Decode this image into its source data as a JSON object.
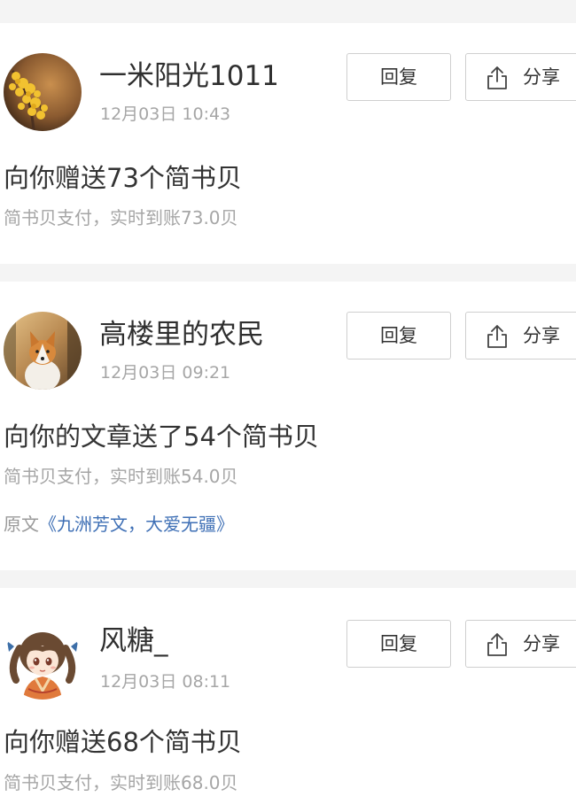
{
  "feed": {
    "items": [
      {
        "username": "一米阳光1011",
        "time": "12月03日 10:43",
        "reply_label": "回复",
        "share_label": "分享",
        "headline": "向你赠送73个简书贝",
        "detail": "简书贝支付，实时到账73.0贝",
        "avatar_icon": "ginkgo-tree-photo"
      },
      {
        "username": "高楼里的农民",
        "time": "12月03日 09:21",
        "reply_label": "回复",
        "share_label": "分享",
        "headline": "向你的文章送了54个简书贝",
        "detail": "简书贝支付，实时到账54.0贝",
        "source_prefix": "原文",
        "source_title": "《九洲芳文，大爱无疆》",
        "avatar_icon": "corgi-dog-photo"
      },
      {
        "username": "风糖_",
        "time": "12月03日 08:11",
        "reply_label": "回复",
        "share_label": "分享",
        "headline": "向你赠送68个简书贝",
        "detail": "简书贝支付，实时到账68.0贝",
        "avatar_icon": "anime-girl-illustration"
      }
    ]
  },
  "colors": {
    "separator": "#f4f4f4",
    "secondary_text": "#a6a6a6",
    "link": "#3e6fb5",
    "primary_text": "#333333"
  }
}
